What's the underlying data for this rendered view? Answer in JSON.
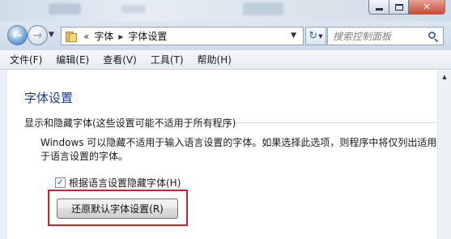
{
  "window": {
    "controls": {
      "minimize_icon": "minimize-icon",
      "maximize_icon": "maximize-icon",
      "close_label": "✕"
    }
  },
  "address_bar": {
    "overflow_glyph": "«",
    "breadcrumbs": [
      "字体",
      "字体设置"
    ],
    "separator": "▸",
    "folder_icon": "fonts-folder-icon"
  },
  "search": {
    "placeholder": "搜索控制面板"
  },
  "menu": {
    "items": [
      "文件(F)",
      "编辑(E)",
      "查看(V)",
      "工具(T)",
      "帮助(H)"
    ]
  },
  "content": {
    "title": "字体设置",
    "group_header": "显示和隐藏字体(这些设置可能不适用于所有程序)",
    "description": "Windows 可以隐藏不适用于输入语言设置的字体。如果选择此选项，则程序中将仅列出适用于语言设置的字体。",
    "checkbox": {
      "label": "根据语言设置隐藏字体(H)",
      "checked": true,
      "mark": "✓"
    },
    "restore_button": "还原默认字体设置(R)"
  },
  "colors": {
    "title_text": "#1e3b87",
    "highlight_border": "#c0272d",
    "chrome": "#dbe6f1"
  }
}
